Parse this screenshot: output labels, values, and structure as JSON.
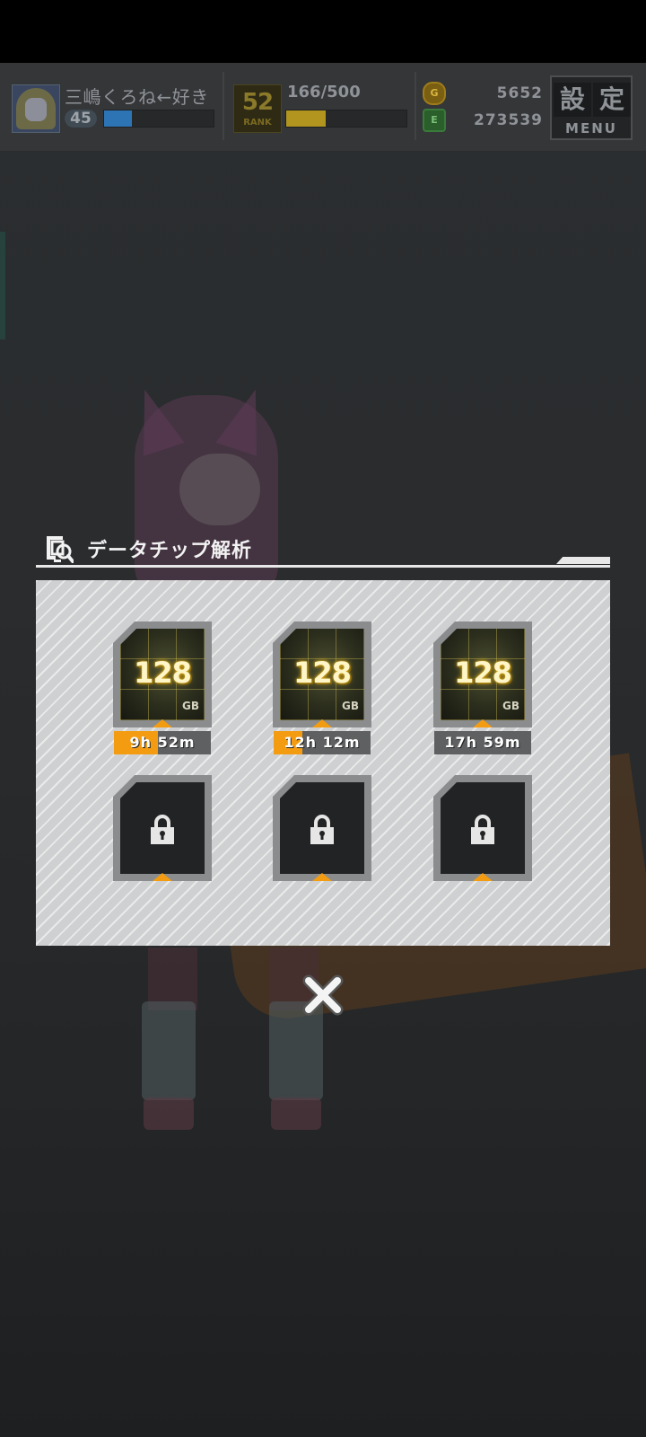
{
  "header": {
    "player_name": "三嶋くろね←好き",
    "level": "45",
    "level_progress": 0.25,
    "rank": "52",
    "rank_label": "RANK",
    "stamina": "166/500",
    "stamina_progress": 0.33,
    "currency_1": {
      "icon": "gem-coin-icon",
      "value": "5652",
      "color": "#c79a12"
    },
    "currency_2": {
      "icon": "battery-icon",
      "value": "273539",
      "color": "#3a8a3a"
    },
    "menu": {
      "kanji_1": "設",
      "kanji_2": "定",
      "label": "MENU"
    }
  },
  "dialog": {
    "title": "データチップ解析",
    "title_icon": "chip-search-icon",
    "accent_color": "#f39c12",
    "slots": [
      {
        "state": "analyzing",
        "size": "128",
        "unit": "GB",
        "timer": "9h 52m",
        "progress": 0.45
      },
      {
        "state": "analyzing",
        "size": "128",
        "unit": "GB",
        "timer": "12h 12m",
        "progress": 0.3
      },
      {
        "state": "analyzing",
        "size": "128",
        "unit": "GB",
        "timer": "17h 59m",
        "progress": 0.0
      },
      {
        "state": "locked",
        "icon": "lock-icon"
      },
      {
        "state": "locked",
        "icon": "lock-icon"
      },
      {
        "state": "locked",
        "icon": "lock-icon"
      }
    ],
    "close_icon": "close-icon"
  }
}
